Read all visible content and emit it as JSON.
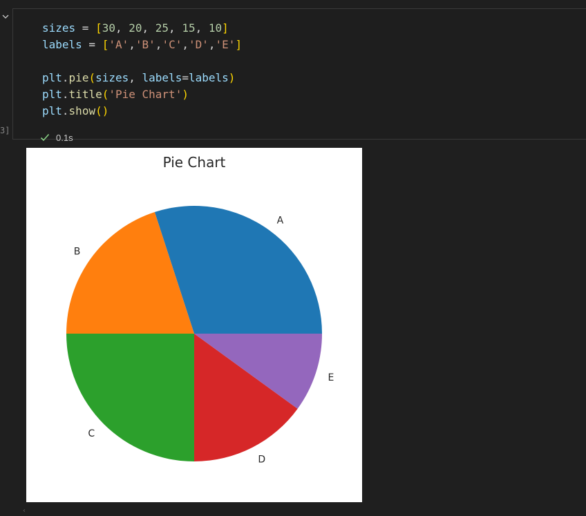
{
  "code_cell": {
    "lines": [
      [
        {
          "t": "sizes",
          "c": "tok-var"
        },
        {
          "t": " = ",
          "c": "tok-op"
        },
        {
          "t": "[",
          "c": "tok-bracket"
        },
        {
          "t": "30",
          "c": "tok-num"
        },
        {
          "t": ", ",
          "c": "tok-punc"
        },
        {
          "t": "20",
          "c": "tok-num"
        },
        {
          "t": ", ",
          "c": "tok-punc"
        },
        {
          "t": "25",
          "c": "tok-num"
        },
        {
          "t": ", ",
          "c": "tok-punc"
        },
        {
          "t": "15",
          "c": "tok-num"
        },
        {
          "t": ", ",
          "c": "tok-punc"
        },
        {
          "t": "10",
          "c": "tok-num"
        },
        {
          "t": "]",
          "c": "tok-bracket"
        }
      ],
      [
        {
          "t": "labels",
          "c": "tok-var"
        },
        {
          "t": " = ",
          "c": "tok-op"
        },
        {
          "t": "[",
          "c": "tok-bracket"
        },
        {
          "t": "'A'",
          "c": "tok-str"
        },
        {
          "t": ",",
          "c": "tok-punc"
        },
        {
          "t": "'B'",
          "c": "tok-str"
        },
        {
          "t": ",",
          "c": "tok-punc"
        },
        {
          "t": "'C'",
          "c": "tok-str"
        },
        {
          "t": ",",
          "c": "tok-punc"
        },
        {
          "t": "'D'",
          "c": "tok-str"
        },
        {
          "t": ",",
          "c": "tok-punc"
        },
        {
          "t": "'E'",
          "c": "tok-str"
        },
        {
          "t": "]",
          "c": "tok-bracket"
        }
      ],
      [],
      [
        {
          "t": "plt",
          "c": "tok-var"
        },
        {
          "t": ".",
          "c": "tok-punc"
        },
        {
          "t": "pie",
          "c": "tok-fn"
        },
        {
          "t": "(",
          "c": "tok-bracket"
        },
        {
          "t": "sizes",
          "c": "tok-var"
        },
        {
          "t": ", ",
          "c": "tok-punc"
        },
        {
          "t": "labels",
          "c": "tok-var"
        },
        {
          "t": "=",
          "c": "tok-op"
        },
        {
          "t": "labels",
          "c": "tok-var"
        },
        {
          "t": ")",
          "c": "tok-bracket"
        }
      ],
      [
        {
          "t": "plt",
          "c": "tok-var"
        },
        {
          "t": ".",
          "c": "tok-punc"
        },
        {
          "t": "title",
          "c": "tok-fn"
        },
        {
          "t": "(",
          "c": "tok-bracket"
        },
        {
          "t": "'Pie Chart'",
          "c": "tok-str"
        },
        {
          "t": ")",
          "c": "tok-bracket"
        }
      ],
      [
        {
          "t": "plt",
          "c": "tok-var"
        },
        {
          "t": ".",
          "c": "tok-punc"
        },
        {
          "t": "show",
          "c": "tok-fn"
        },
        {
          "t": "()",
          "c": "tok-bracket"
        }
      ]
    ],
    "execution_count": "3]",
    "exec_time": "0.1s",
    "status_icon": "check-icon",
    "toggle_icon": "chevron-down-icon"
  },
  "chart_data": {
    "type": "pie",
    "title": "Pie Chart",
    "categories": [
      "A",
      "B",
      "C",
      "D",
      "E"
    ],
    "values": [
      30,
      20,
      25,
      15,
      10
    ],
    "colors": [
      "#1f77b4",
      "#ff7f0e",
      "#2ca02c",
      "#d62728",
      "#9467bd"
    ],
    "start_angle_deg": 0,
    "direction": "counterclockwise"
  }
}
